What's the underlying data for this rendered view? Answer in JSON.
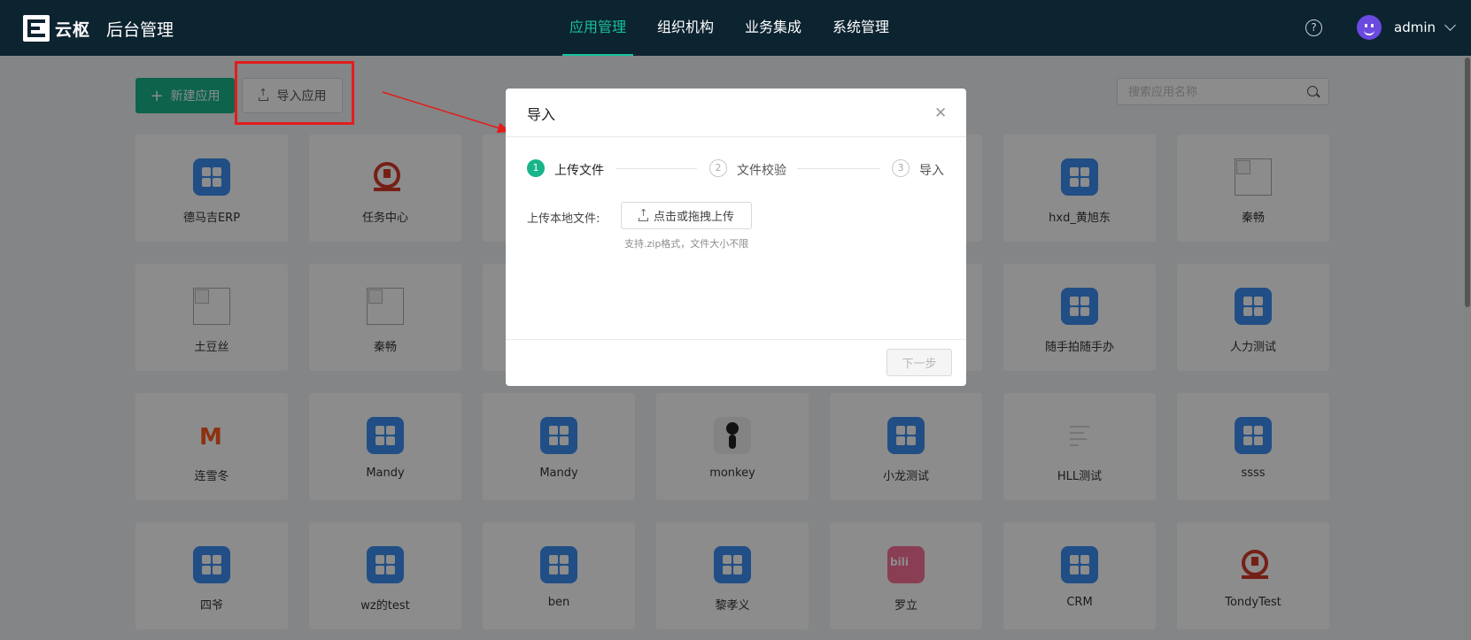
{
  "header": {
    "brand": "云枢",
    "title": "后台管理",
    "nav": [
      {
        "label": "应用管理",
        "active": true
      },
      {
        "label": "组织机构",
        "active": false
      },
      {
        "label": "业务集成",
        "active": false
      },
      {
        "label": "系统管理",
        "active": false
      }
    ],
    "help_icon": "question-circle-icon",
    "user": {
      "name": "admin",
      "avatar_icon": "smiley-avatar-icon"
    }
  },
  "toolbar": {
    "new_label": "新建应用",
    "import_label": "导入应用",
    "search_placeholder": "搜索应用名称"
  },
  "apps": [
    {
      "name": "德马吉ERP",
      "icon": "grid-app"
    },
    {
      "name": "任务中心",
      "icon": "rail"
    },
    {
      "name": "",
      "icon": "grid-app"
    },
    {
      "name": "",
      "icon": "grid-app"
    },
    {
      "name": "",
      "icon": "grid-app"
    },
    {
      "name": "hxd_黄旭东",
      "icon": "grid-app"
    },
    {
      "name": "秦畅",
      "icon": "broken"
    },
    {
      "name": "土豆丝",
      "icon": "broken"
    },
    {
      "name": "秦畅",
      "icon": "broken"
    },
    {
      "name": "",
      "icon": "grid-app"
    },
    {
      "name": "",
      "icon": "grid-app"
    },
    {
      "name": "",
      "icon": "grid-app"
    },
    {
      "name": "随手拍随手办",
      "icon": "grid-app"
    },
    {
      "name": "人力测试",
      "icon": "grid-app"
    },
    {
      "name": "连雪冬",
      "icon": "mango"
    },
    {
      "name": "Mandy",
      "icon": "grid-app"
    },
    {
      "name": "Mandy",
      "icon": "grid-app"
    },
    {
      "name": "monkey",
      "icon": "monkey"
    },
    {
      "name": "小龙测试",
      "icon": "grid-app"
    },
    {
      "name": "HLL测试",
      "icon": "hll"
    },
    {
      "name": "ssss",
      "icon": "grid-app"
    },
    {
      "name": "四爷",
      "icon": "grid-app"
    },
    {
      "name": "wz的test",
      "icon": "grid-app"
    },
    {
      "name": "ben",
      "icon": "grid-app"
    },
    {
      "name": "黎孝义",
      "icon": "grid-app"
    },
    {
      "name": "罗立",
      "icon": "bili"
    },
    {
      "name": "CRM",
      "icon": "grid-app"
    },
    {
      "name": "TondyTest",
      "icon": "rail"
    }
  ],
  "modal": {
    "title": "导入",
    "close_icon": "close-icon",
    "steps": [
      {
        "num": "1",
        "label": "上传文件",
        "active": true
      },
      {
        "num": "2",
        "label": "文件校验",
        "active": false
      },
      {
        "num": "3",
        "label": "导入",
        "active": false
      }
    ],
    "upload_label": "上传本地文件:",
    "upload_button": "点击或拖拽上传",
    "upload_hint": "支持.zip格式，文件大小不限",
    "next_label": "下一步"
  },
  "colors": {
    "header_bg": "#0c2330",
    "accent": "#18b48a",
    "app_blue": "#3d8ef2",
    "annotation_red": "#e21d1d"
  }
}
